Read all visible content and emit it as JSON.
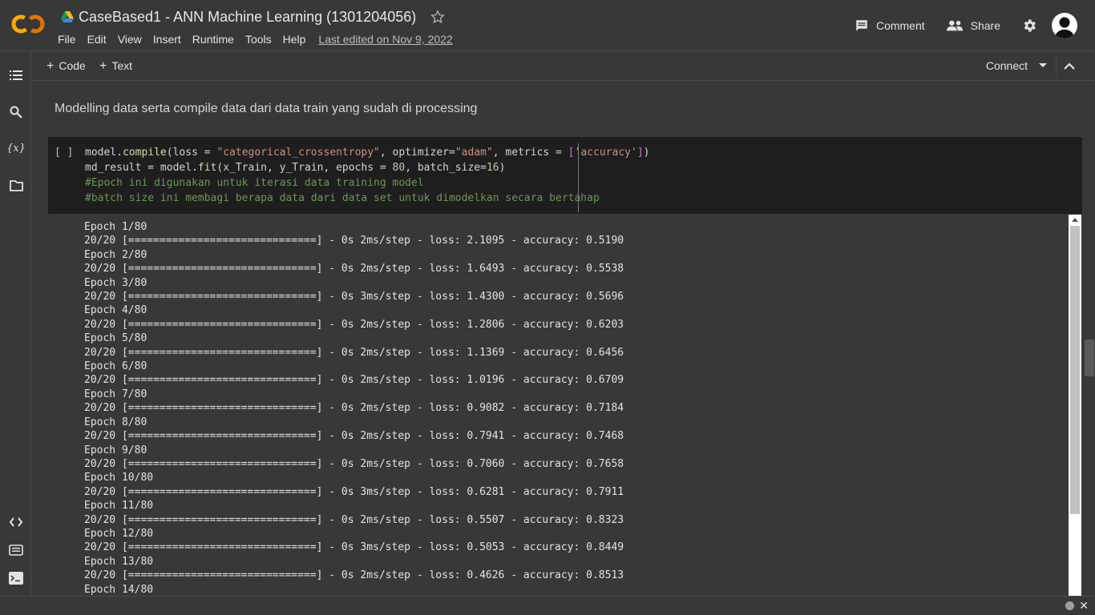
{
  "header": {
    "title": "CaseBased1 - ANN Machine Learning (1301204056)",
    "menu": [
      "File",
      "Edit",
      "View",
      "Insert",
      "Runtime",
      "Tools",
      "Help"
    ],
    "last_edited": "Last edited on Nov 9, 2022",
    "comment_label": "Comment",
    "share_label": "Share"
  },
  "toolbar": {
    "code_label": "Code",
    "text_label": "Text",
    "connect_label": "Connect"
  },
  "text_cell": "Modelling data serta compile data dari data train yang sudah di processing",
  "code_cell": {
    "run_marker": "[ ]",
    "lines": [
      "model.compile(loss = \"categorical_crossentropy\", optimizer=\"adam\", metrics = ['accuracy'])",
      "md_result = model.fit(x_Train, y_Train, epochs = 80, batch_size=16)",
      "#Epoch ini digunakan untuk iterasi data training model",
      "#batch size ini membagi berapa data dari data set untuk dimodelkan secara bertahap"
    ]
  },
  "output": {
    "total_epochs": 80,
    "steps": "20/20",
    "bar": "[==============================]",
    "epochs": [
      {
        "epoch": 1,
        "time": "0s 2ms/step",
        "loss": "2.1095",
        "accuracy": "0.5190"
      },
      {
        "epoch": 2,
        "time": "0s 2ms/step",
        "loss": "1.6493",
        "accuracy": "0.5538"
      },
      {
        "epoch": 3,
        "time": "0s 3ms/step",
        "loss": "1.4300",
        "accuracy": "0.5696"
      },
      {
        "epoch": 4,
        "time": "0s 2ms/step",
        "loss": "1.2806",
        "accuracy": "0.6203"
      },
      {
        "epoch": 5,
        "time": "0s 2ms/step",
        "loss": "1.1369",
        "accuracy": "0.6456"
      },
      {
        "epoch": 6,
        "time": "0s 2ms/step",
        "loss": "1.0196",
        "accuracy": "0.6709"
      },
      {
        "epoch": 7,
        "time": "0s 2ms/step",
        "loss": "0.9082",
        "accuracy": "0.7184"
      },
      {
        "epoch": 8,
        "time": "0s 2ms/step",
        "loss": "0.7941",
        "accuracy": "0.7468"
      },
      {
        "epoch": 9,
        "time": "0s 2ms/step",
        "loss": "0.7060",
        "accuracy": "0.7658"
      },
      {
        "epoch": 10,
        "time": "0s 3ms/step",
        "loss": "0.6281",
        "accuracy": "0.7911"
      },
      {
        "epoch": 11,
        "time": "0s 2ms/step",
        "loss": "0.5507",
        "accuracy": "0.8323"
      },
      {
        "epoch": 12,
        "time": "0s 3ms/step",
        "loss": "0.5053",
        "accuracy": "0.8449"
      },
      {
        "epoch": 13,
        "time": "0s 2ms/step",
        "loss": "0.4626",
        "accuracy": "0.8513"
      }
    ],
    "trailing_epoch_line": "Epoch 14/80"
  },
  "icons": {
    "rail": [
      "toc-icon",
      "search-icon",
      "variables-icon",
      "files-icon",
      "code-snippets-icon",
      "command-palette-icon",
      "terminal-icon"
    ],
    "variables_glyph": "{x}"
  },
  "colors": {
    "background": "#383838",
    "code_background": "#1e1e1e",
    "logo_orange": "#f9ab00",
    "logo_dark_orange": "#e37400",
    "string": "#ce9178",
    "comment": "#6a9955",
    "number": "#b5cea8"
  }
}
